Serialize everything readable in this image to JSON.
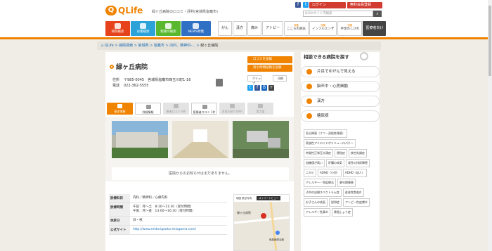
{
  "header": {
    "logo_text": "QLife",
    "tagline": "緑ヶ丘病院の口コミ・評判(宮城県塩竈市)",
    "login": "ログイン",
    "register": "無料会員登録",
    "search_placeholder": "QLifeサイト内検索"
  },
  "categories": [
    {
      "label": "病院検索",
      "color": "#e6421b"
    },
    {
      "label": "お薬検索",
      "color": "#2ba3d9"
    },
    {
      "label": "製薬の検索",
      "color": "#5ab82f"
    },
    {
      "label": "NEWS特集",
      "color": "#2f6fc4"
    }
  ],
  "subnav": [
    {
      "label": "がん"
    },
    {
      "label": "漢方"
    },
    {
      "label": "痛み"
    },
    {
      "label": "アトピー"
    }
  ],
  "subnav2": [
    {
      "tag": "特集",
      "label": "こころの病気"
    },
    {
      "tag": "特集",
      "label": "インフルエンザ"
    },
    {
      "tag": "特集",
      "label": "手足のしびれ"
    }
  ],
  "rx": "医療者向け",
  "breadcrumb": [
    "QLife",
    "病院検索",
    "宮城県",
    "塩竈市",
    "内科、精神科-...",
    "緑ヶ丘病院"
  ],
  "hospital": {
    "name": "緑ヶ丘病院",
    "address_label": "住所",
    "address": "〒985-0045　宮城県塩竈市西玉川町1-16",
    "phone_label": "電話",
    "phone": "022-362-5555"
  },
  "actions": {
    "review": "口コミを投稿",
    "reserve": "待ち時間投稿を投稿",
    "clip": "クリップ",
    "print": "印刷"
  },
  "tabs": [
    "基本情報",
    "詳細情報",
    "患者口コミ 0件",
    "医療者口コミ 1件",
    "名医の紹介(0件)",
    "実力度"
  ],
  "notice": "医院からのお知らせはまだありません。",
  "details": [
    {
      "k": "診療科目",
      "v": "内科／精神科／心療内科"
    },
    {
      "k": "診療時間",
      "v": "午前：月〜土　8:30〜11:30（受付時間）\n午後：月〜金　13:00〜16:30（受付時間）"
    },
    {
      "k": "休診日",
      "v": "日・祝"
    },
    {
      "k": "公式サイト",
      "v": "http://www.midorigaoka-shiogama.com/"
    }
  ],
  "map": {
    "tab1": "地図",
    "tab2": "航空写真",
    "street": "ストリートビュー",
    "pin_label": "緑ヶ丘病院",
    "place2": "塩釜医師会館"
  },
  "sidebar": {
    "title": "相談できる病院を探す",
    "buttons": [
      "片目でゆがんで見える",
      "脳卒中・心房細動",
      "漢方",
      "糖尿病"
    ],
    "chips": [
      "気分障害（うつ・双極性障害）",
      "家族性アミロイドポリニューロパチー",
      "特発性正常圧水頭症",
      "便秘症",
      "統合失調症",
      "血糖値が高い",
      "肝臓の病気",
      "発性の排尿障害",
      "ニキビ",
      "ADHD（小児）",
      "ADHD（成人）",
      "アレルギー・免疫療法",
      "更年期障害",
      "子供の自閉スペクトラム症",
      "逆流性食道炎",
      "お子さんの成長",
      "認知症",
      "アトピー性皮膚炎",
      "アレルギー性鼻炎",
      "骨粗しょう症"
    ]
  },
  "colors": {
    "accent": "#f08300",
    "red": "#d23b2f"
  }
}
